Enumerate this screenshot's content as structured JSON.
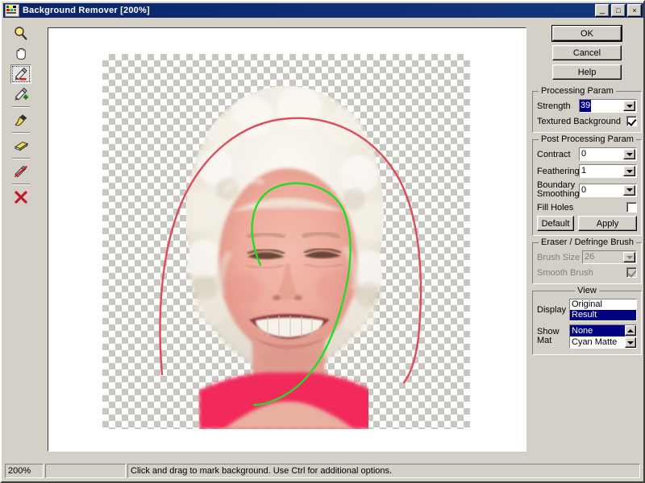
{
  "window": {
    "title": "Background Remover [200%]",
    "icon": "app-image-icon",
    "buttons": {
      "minimize": "_",
      "maximize": "□",
      "close": "×"
    },
    "titlebar_color": "#0a246a",
    "face_color": "#d4d0c8"
  },
  "toolbar": {
    "tools": [
      {
        "name": "zoom-tool",
        "icon": "magnifier-icon",
        "selected": false
      },
      {
        "name": "pan-tool",
        "icon": "hand-icon",
        "selected": false
      },
      {
        "name": "mark-background-tool",
        "icon": "pen-minus-red-icon",
        "selected": true
      },
      {
        "name": "mark-foreground-tool",
        "icon": "pen-plus-green-icon",
        "selected": false
      },
      {
        "name": "brush-tool",
        "icon": "paint-brush-icon",
        "selected": false
      },
      {
        "name": "eraser-tool",
        "icon": "eraser-icon",
        "selected": false
      },
      {
        "name": "defringe-tool",
        "icon": "defringe-crossed-icon",
        "selected": false
      },
      {
        "name": "clear-marks-tool",
        "icon": "red-x-icon",
        "selected": false
      }
    ]
  },
  "canvas": {
    "zoom": "200%",
    "background_stroke_color": "#e04a5a",
    "foreground_stroke_color": "#22dd22",
    "checker_light": "#ffffff",
    "checker_dark": "#c8c8c0"
  },
  "actions": {
    "ok": "OK",
    "cancel": "Cancel",
    "help": "Help"
  },
  "processing_param": {
    "legend": "Processing Param",
    "strength_label": "Strength",
    "strength_value": "39",
    "textured_background_label": "Textured Background",
    "textured_background_checked": true
  },
  "post_processing_param": {
    "legend": "Post Processing Param",
    "contract_label": "Contract",
    "contract_value": "0",
    "feathering_label": "Feathering",
    "feathering_value": "1",
    "boundary_smoothing_label_1": "Boundary",
    "boundary_smoothing_label_2": "Smoothing",
    "boundary_smoothing_value": "0",
    "fill_holes_label": "Fill Holes",
    "fill_holes_checked": false,
    "default_button": "Default",
    "apply_button": "Apply"
  },
  "eraser_defringe_brush": {
    "legend": "Eraser / Defringe  Brush",
    "enabled": false,
    "brush_size_label": "Brush Size",
    "brush_size_value": "26",
    "smooth_brush_label": "Smooth Brush",
    "smooth_brush_checked": true
  },
  "view": {
    "legend": "View",
    "display_label": "Display",
    "display_options": [
      "Original",
      "Result"
    ],
    "display_selected": "Result",
    "show_mat_label_1": "Show",
    "show_mat_label_2": "Mat",
    "show_mat_options": [
      "None",
      "Cyan Matte"
    ],
    "show_mat_selected": "None"
  },
  "statusbar": {
    "zoom": "200%",
    "progress": "",
    "message": "Click and drag to mark background. Use Ctrl for additional options."
  }
}
